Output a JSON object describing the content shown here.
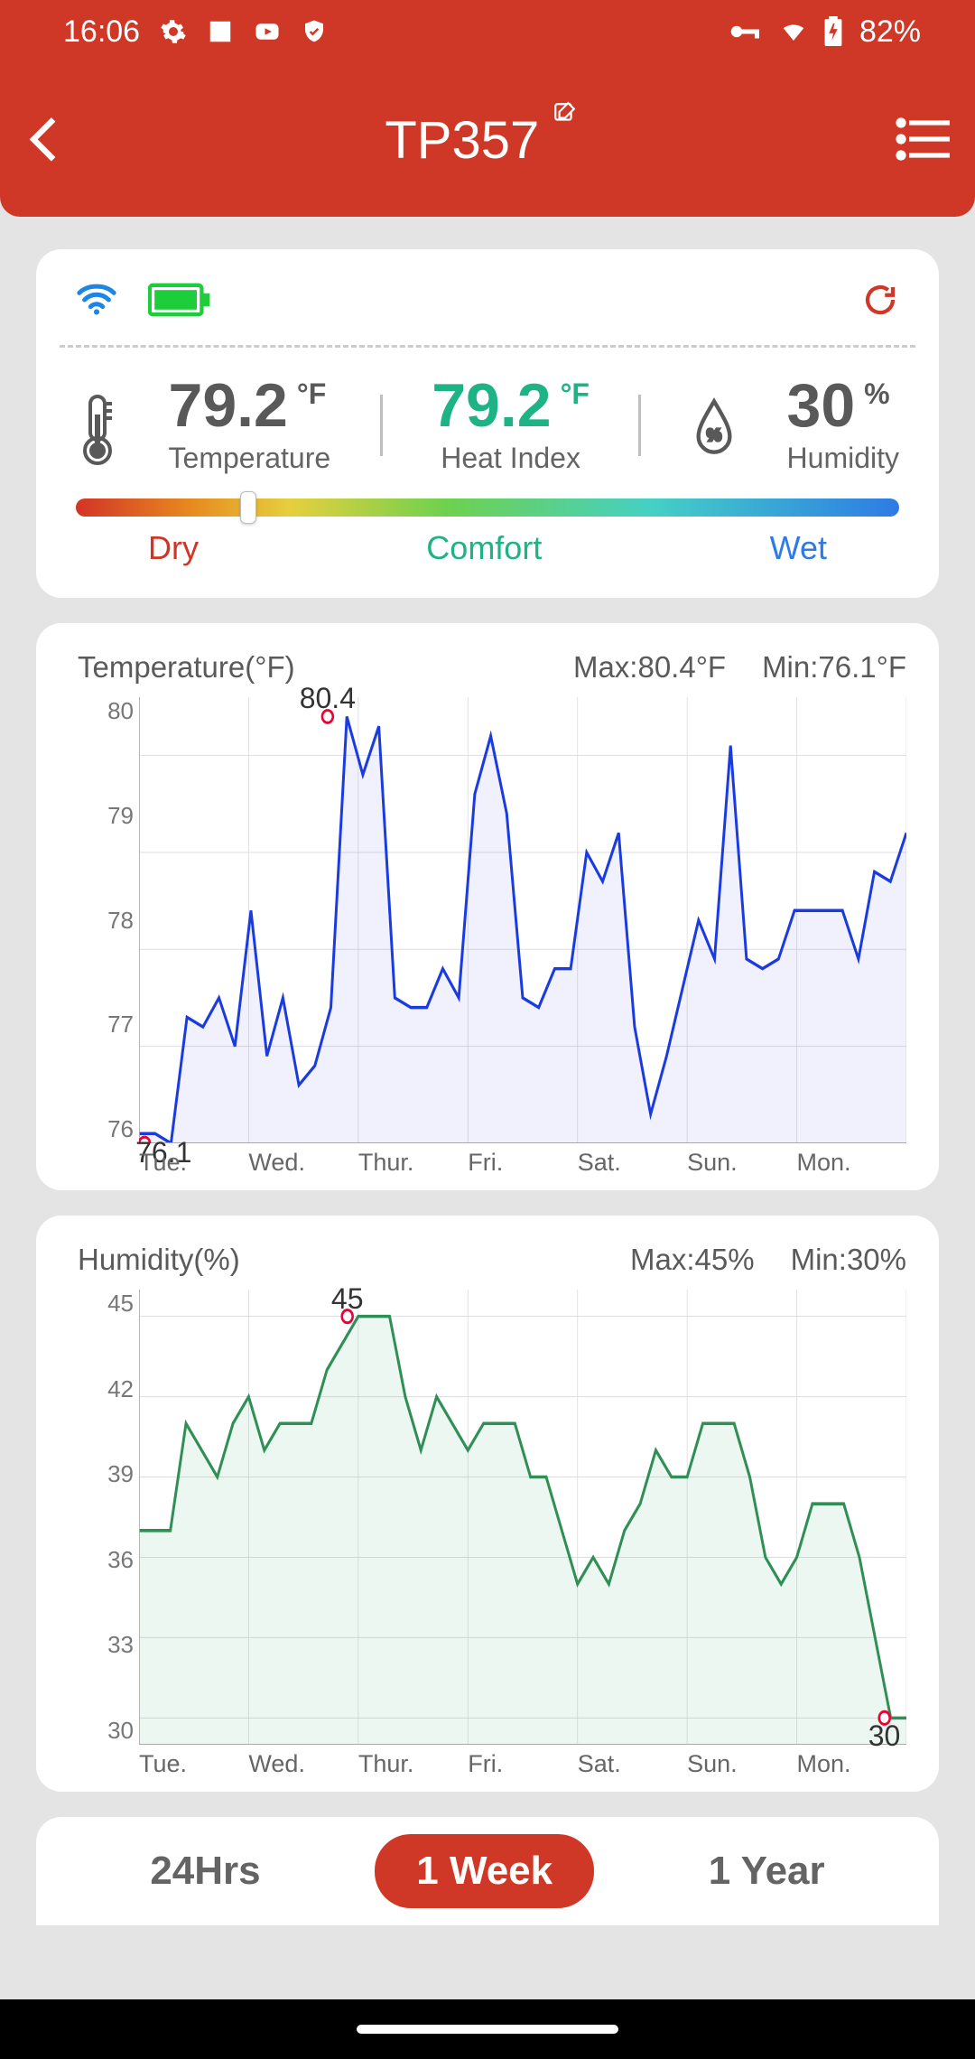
{
  "status_bar": {
    "time": "16:06",
    "battery": "82%"
  },
  "header": {
    "title": "TP357"
  },
  "device": {
    "temp_value": "79.2",
    "temp_unit": "°F",
    "temp_label": "Temperature",
    "heat_value": "79.2",
    "heat_unit": "°F",
    "heat_label": "Heat Index",
    "hum_value": "30",
    "hum_unit": "%",
    "hum_label": "Humidity",
    "handle_percent": 20,
    "comfort": {
      "dry": "Dry",
      "comfort": "Comfort",
      "wet": "Wet"
    }
  },
  "chart_data": [
    {
      "type": "line",
      "title": "Temperature(°F)",
      "max_label": "Max:80.4°F",
      "min_label": "Min:76.1°F",
      "x_categories": [
        "Tue.",
        "Wed.",
        "Thur.",
        "Fri.",
        "Sat.",
        "Sun.",
        "Mon."
      ],
      "y_ticks": [
        "80",
        "79",
        "78",
        "77",
        "76"
      ],
      "ylim": [
        76,
        80.6
      ],
      "peak": {
        "value": "80.4",
        "x_index": 1.72
      },
      "trough": {
        "value": "76.1",
        "x_index": 0.05
      },
      "values": [
        76.1,
        76.1,
        76.0,
        77.3,
        77.2,
        77.5,
        77.0,
        78.4,
        76.9,
        77.5,
        76.6,
        76.8,
        77.4,
        80.4,
        79.8,
        80.3,
        77.5,
        77.4,
        77.4,
        77.8,
        77.5,
        79.6,
        80.2,
        79.4,
        77.5,
        77.4,
        77.8,
        77.8,
        79.0,
        78.7,
        79.2,
        77.2,
        76.3,
        76.9,
        77.6,
        78.3,
        77.9,
        80.1,
        77.9,
        77.8,
        77.9,
        78.4,
        78.4,
        78.4,
        78.4,
        77.9,
        78.8,
        78.7,
        79.2
      ]
    },
    {
      "type": "line",
      "title": "Humidity(%)",
      "max_label": "Max:45%",
      "min_label": "Min:30%",
      "x_categories": [
        "Tue.",
        "Wed.",
        "Thur.",
        "Fri.",
        "Sat.",
        "Sun.",
        "Mon."
      ],
      "y_ticks": [
        "45",
        "42",
        "39",
        "36",
        "33",
        "30"
      ],
      "ylim": [
        29,
        46
      ],
      "peak": {
        "value": "45",
        "x_index": 1.9
      },
      "trough": {
        "value": "30",
        "x_index": 6.8
      },
      "values": [
        37,
        37,
        37,
        41,
        40,
        39,
        41,
        42,
        40,
        41,
        41,
        41,
        43,
        44,
        45,
        45,
        45,
        42,
        40,
        42,
        41,
        40,
        41,
        41,
        41,
        39,
        39,
        37,
        35,
        36,
        35,
        37,
        38,
        40,
        39,
        39,
        41,
        41,
        41,
        39,
        36,
        35,
        36,
        38,
        38,
        38,
        36,
        33,
        30,
        30
      ]
    }
  ],
  "range": {
    "tabs": [
      "24Hrs",
      "1 Week",
      "1 Year"
    ],
    "active": 1
  }
}
